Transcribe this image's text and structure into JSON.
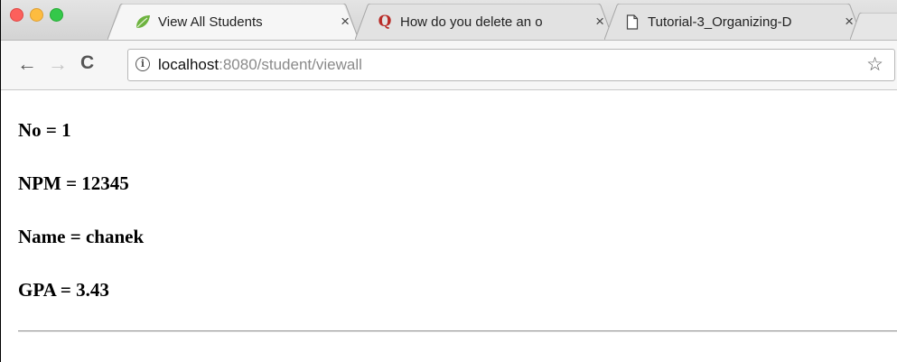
{
  "window": {
    "controls": {
      "close": "#fc605c",
      "minimize": "#fdbc40",
      "maximize": "#34c84a"
    }
  },
  "tabs": [
    {
      "title": "View All Students",
      "icon": "spring-leaf-icon",
      "active": true,
      "close": "×"
    },
    {
      "title": "How do you delete an o",
      "icon": "quora-q-icon",
      "active": false,
      "close": "×"
    },
    {
      "title": "Tutorial-3_Organizing-D",
      "icon": "document-icon",
      "active": false,
      "close": "×"
    }
  ],
  "toolbar": {
    "back": "←",
    "forward": "→",
    "reload": "C",
    "url_host": "localhost",
    "url_path": ":8080/student/viewall",
    "info": "i",
    "star": "☆"
  },
  "student": {
    "no": "No = 1",
    "npm": "NPM = 12345",
    "name": "Name = chanek",
    "gpa": "GPA = 3.43"
  },
  "colors": {
    "accent_quora": "#b92b27",
    "spring_green": "#6db33f"
  }
}
